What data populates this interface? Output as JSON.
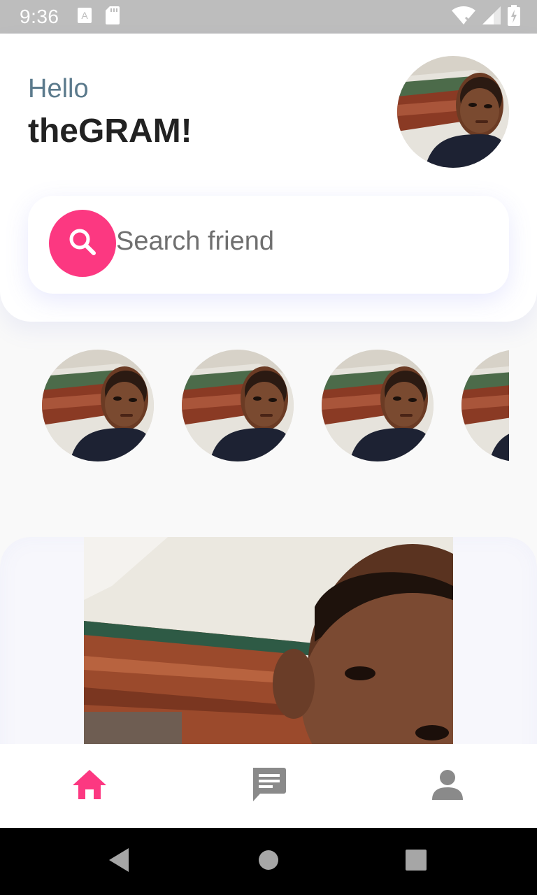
{
  "status_bar": {
    "time": "9:36",
    "icons": [
      "font-download-icon",
      "sd-card-icon",
      "wifi-off-icon",
      "cell-signal-icon",
      "battery-icon"
    ]
  },
  "header": {
    "greeting": "Hello",
    "title": "theGRAM!",
    "avatar": "profile-photo"
  },
  "search": {
    "placeholder": "Search friend",
    "icon": "search-icon",
    "accent_color": "#fc3881"
  },
  "stories": {
    "items": [
      {
        "avatar": "story-photo"
      },
      {
        "avatar": "story-photo"
      },
      {
        "avatar": "story-photo"
      },
      {
        "avatar": "story-photo"
      }
    ]
  },
  "feed": {
    "post_image": "post-photo"
  },
  "bottom_nav": {
    "items": [
      {
        "icon": "home-icon",
        "active": true
      },
      {
        "icon": "chat-icon",
        "active": false
      },
      {
        "icon": "person-icon",
        "active": false
      }
    ],
    "active_color": "#fc3881",
    "inactive_color": "#8a8a8a"
  },
  "system_nav": {
    "buttons": [
      "back-icon",
      "home-circle-icon",
      "recents-icon"
    ]
  }
}
